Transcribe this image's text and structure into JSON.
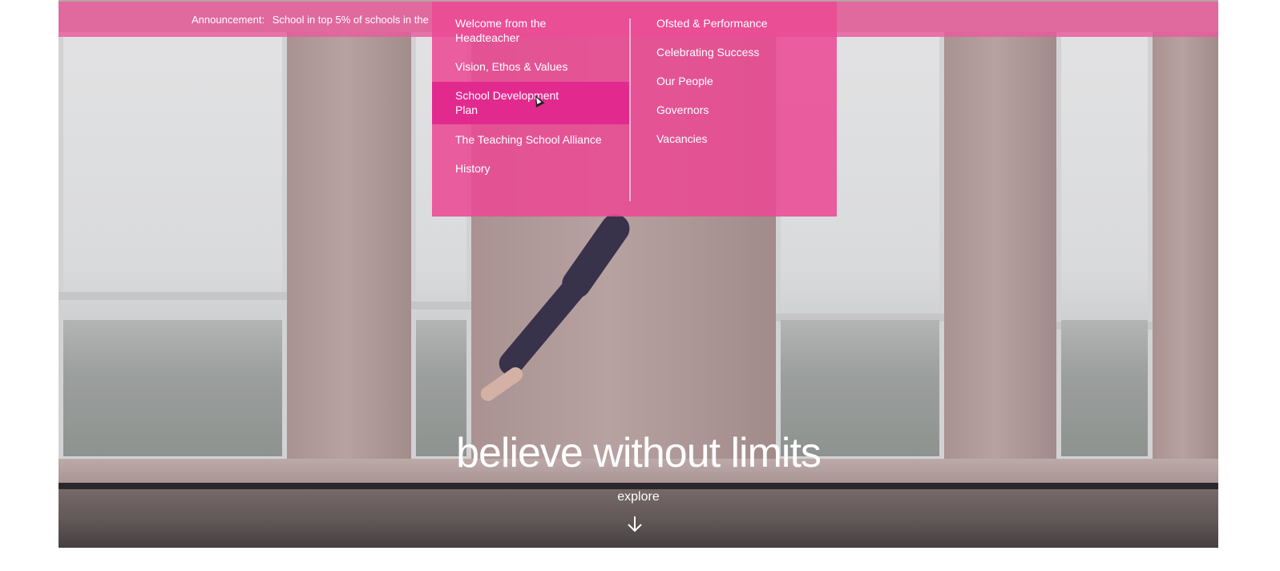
{
  "announcement": {
    "label": "Announcement:",
    "text": "School in top 5% of schools in the"
  },
  "dropdown": {
    "left_items": [
      {
        "label": "Welcome from the Headteacher"
      },
      {
        "label": "Vision, Ethos & Values"
      },
      {
        "label": "School Development Plan",
        "active": true
      },
      {
        "label": "The Teaching School Alliance"
      },
      {
        "label": "History"
      }
    ],
    "right_items": [
      {
        "label": "Ofsted & Performance"
      },
      {
        "label": "Celebrating Success"
      },
      {
        "label": "Our People"
      },
      {
        "label": "Governors"
      },
      {
        "label": "Vacancies"
      }
    ]
  },
  "hero": {
    "tagline": "believe without limits",
    "explore_label": "explore",
    "arrow_icon": "arrow-down-icon"
  },
  "colors": {
    "brand_pink": "#ea4a94",
    "active_pink": "#e22a8e",
    "text": "#ffffff"
  }
}
